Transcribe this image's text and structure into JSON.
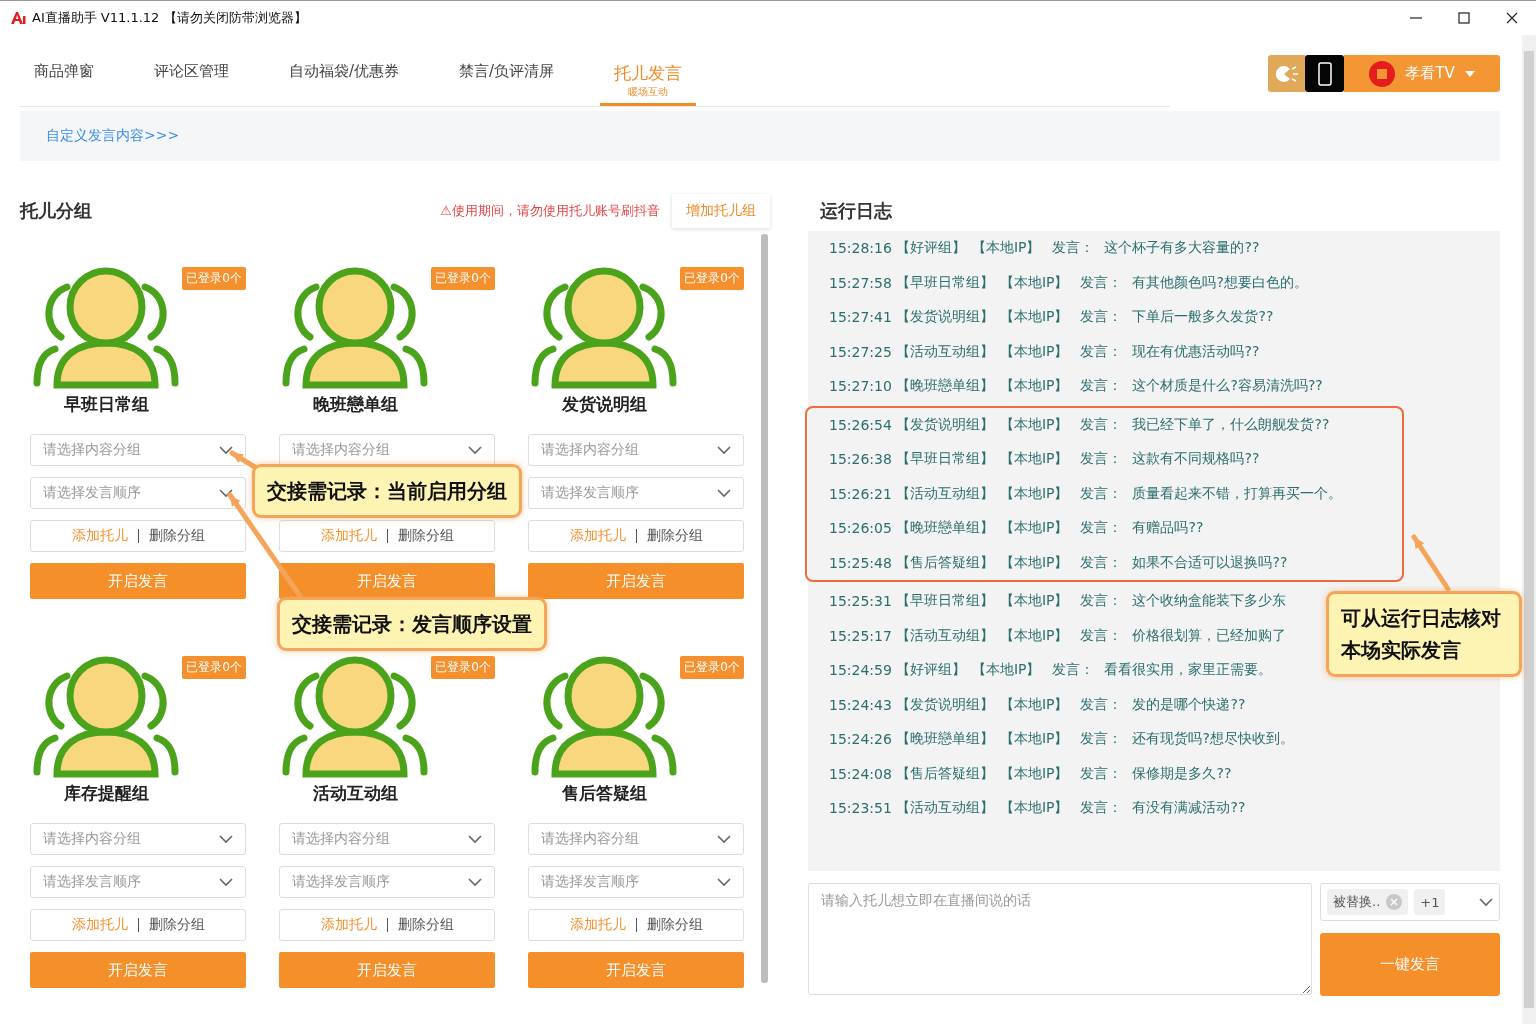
{
  "window": {
    "title": "AI直播助手 V11.1.12 【请勿关闭防带浏览器】"
  },
  "tabs": [
    {
      "label": "商品弹窗",
      "selected": false
    },
    {
      "label": "评论区管理",
      "selected": false
    },
    {
      "label": "自动福袋/优惠券",
      "selected": false
    },
    {
      "label": "禁言/负评清屏",
      "selected": false
    },
    {
      "label": "托儿发言",
      "sublabel": "暖场互动",
      "selected": true
    }
  ],
  "account": {
    "name": "孝看TV"
  },
  "custom_link": "自定义发言内容>>>",
  "groups_panel": {
    "title": "托儿分组",
    "warning": "⚠使用期间，请勿使用托儿账号刷抖音",
    "add_button": "增加托儿组",
    "groups": [
      {
        "name": "早班日常组",
        "badge": "已登录0个",
        "content_placeholder": "请选择内容分组",
        "order_placeholder": "请选择发言顺序",
        "add_label": "添加托儿",
        "delete_label": "删除分组",
        "start_label": "开启发言"
      },
      {
        "name": "晚班戀单组",
        "badge": "已登录0个",
        "content_placeholder": "请选择内容分组",
        "add_label": "添加托儿",
        "delete_label": "删除分组",
        "start_label": "开启发言"
      },
      {
        "name": "发货说明组",
        "badge": "已登录0个",
        "content_placeholder": "请选择内容分组",
        "order_placeholder": "请选择发言顺序",
        "add_label": "添加托儿",
        "delete_label": "删除分组",
        "start_label": "开启发言"
      },
      {
        "name": "库存提醒组",
        "badge": "已登录0个",
        "content_placeholder": "请选择内容分组",
        "order_placeholder": "请选择发言顺序",
        "add_label": "添加托儿",
        "delete_label": "删除分组",
        "start_label": "开启发言"
      },
      {
        "name": "活动互动组",
        "badge": "已登录0个",
        "content_placeholder": "请选择内容分组",
        "order_placeholder": "请选择发言顺序",
        "add_label": "添加托儿",
        "delete_label": "删除分组",
        "start_label": "开启发言"
      },
      {
        "name": "售后答疑组",
        "badge": "已登录0个",
        "content_placeholder": "请选择内容分组",
        "order_placeholder": "请选择发言顺序",
        "add_label": "添加托儿",
        "delete_label": "删除分组",
        "start_label": "开启发言"
      }
    ]
  },
  "log": {
    "title": "运行日志",
    "entries": [
      {
        "time": "15:28:16",
        "group": "【好评组】",
        "ip": "【本地IP】",
        "label": "发言：",
        "text": "这个杯子有多大容量的??",
        "highlighted": false
      },
      {
        "time": "15:27:58",
        "group": "【早班日常组】",
        "ip": "【本地IP】",
        "label": "发言：",
        "text": "有其他颜色吗?想要白色的。",
        "highlighted": false
      },
      {
        "time": "15:27:41",
        "group": "【发货说明组】",
        "ip": "【本地IP】",
        "label": "发言：",
        "text": "下单后一般多久发货??",
        "highlighted": false
      },
      {
        "time": "15:27:25",
        "group": "【活动互动组】",
        "ip": "【本地IP】",
        "label": "发言：",
        "text": "现在有优惠活动吗??",
        "highlighted": false
      },
      {
        "time": "15:27:10",
        "group": "【晚班戀单组】",
        "ip": "【本地IP】",
        "label": "发言：",
        "text": "这个材质是什么?容易清洗吗??",
        "highlighted": false
      },
      {
        "time": "15:26:54",
        "group": "【发货说明组】",
        "ip": "【本地IP】",
        "label": "发言：",
        "text": "我已经下单了，什么朗舰发货??",
        "highlighted": true
      },
      {
        "time": "15:26:38",
        "group": "【早班日常组】",
        "ip": "【本地IP】",
        "label": "发言：",
        "text": "这款有不同规格吗??",
        "highlighted": true
      },
      {
        "time": "15:26:21",
        "group": "【活动互动组】",
        "ip": "【本地IP】",
        "label": "发言：",
        "text": "质量看起来不错，打算再买一个。",
        "highlighted": true
      },
      {
        "time": "15:26:05",
        "group": "【晚班戀单组】",
        "ip": "【本地IP】",
        "label": "发言：",
        "text": "有赠品吗??",
        "highlighted": true
      },
      {
        "time": "15:25:48",
        "group": "【售后答疑组】",
        "ip": "【本地IP】",
        "label": "发言：",
        "text": "如果不合适可以退换吗??",
        "highlighted": true
      },
      {
        "time": "15:25:31",
        "group": "【早班日常组】",
        "ip": "【本地IP】",
        "label": "发言：",
        "text": "这个收纳盒能装下多少东",
        "highlighted": false
      },
      {
        "time": "15:25:17",
        "group": "【活动互动组】",
        "ip": "【本地IP】",
        "label": "发言：",
        "text": "价格很划算，已经加购了",
        "highlighted": false
      },
      {
        "time": "15:24:59",
        "group": "【好评组】",
        "ip": "【本地IP】",
        "label": "发言：",
        "text": "看看很实用，家里正需要。",
        "highlighted": false
      },
      {
        "time": "15:24:43",
        "group": "【发货说明组】",
        "ip": "【本地IP】",
        "label": "发言：",
        "text": "发的是哪个快递??",
        "highlighted": false
      },
      {
        "time": "15:24:26",
        "group": "【晚班戀单组】",
        "ip": "【本地IP】",
        "label": "发言：",
        "text": "还有现货吗?想尽快收到。",
        "highlighted": false
      },
      {
        "time": "15:24:08",
        "group": "【售后答疑组】",
        "ip": "【本地IP】",
        "label": "发言：",
        "text": "保修期是多久??",
        "highlighted": false
      },
      {
        "time": "15:23:51",
        "group": "【活动互动组】",
        "ip": "【本地IP】",
        "label": "发言：",
        "text": "有没有满减活动??",
        "highlighted": false
      }
    ]
  },
  "composer": {
    "placeholder": "请输入托儿想立即在直播间说的话",
    "tags": [
      {
        "label": "被替换..",
        "removable": true
      },
      {
        "label": "+1",
        "removable": false
      }
    ],
    "button": "一键发言"
  },
  "callouts": [
    {
      "kind": "content-select",
      "text": "交接需记录：当前启用分组"
    },
    {
      "kind": "order-select",
      "text": "交接需记录：发言顺序设置"
    },
    {
      "kind": "log",
      "text": "可从运行日志核对本场实际发言"
    }
  ]
}
